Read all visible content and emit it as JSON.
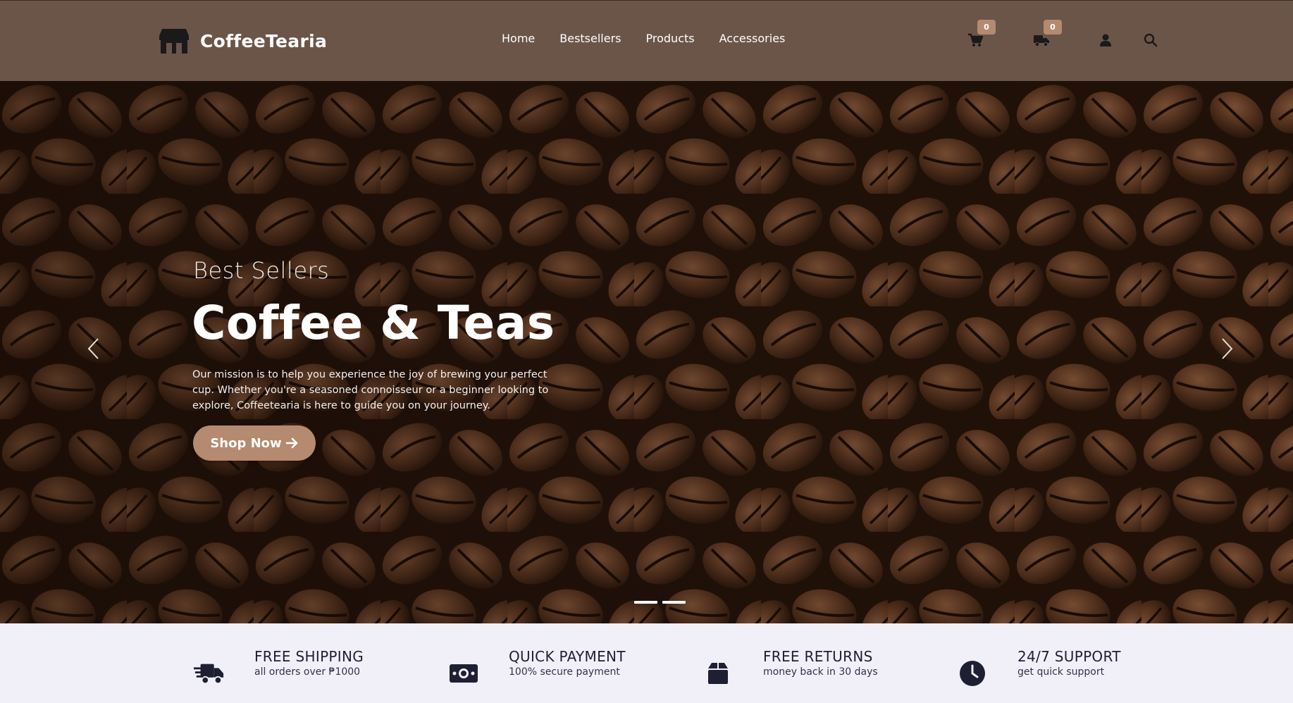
{
  "header": {
    "brand_name": "CoffeeTearia",
    "nav": [
      "Home",
      "Bestsellers",
      "Products",
      "Accessories"
    ],
    "cart_count": "0",
    "orders_count": "0",
    "icons": [
      "store-icon",
      "cart-icon",
      "truck-icon",
      "user-icon",
      "search-icon"
    ]
  },
  "hero": {
    "subtitle": "Best Sellers",
    "title": "Coffee & Teas",
    "description": "Our mission is to help you experience the joy of brewing your perfect cup. Whether you're a seasoned connoisseur or a beginner looking to explore, Coffeetearia is here to guide you on your journey.",
    "cta_label": "Shop Now",
    "slides": 2
  },
  "features": [
    {
      "title": "FREE SHIPPING",
      "desc": "all orders over ₱1000",
      "icon": "shipping-truck-icon"
    },
    {
      "title": "QUICK PAYMENT",
      "desc": "100% secure payment",
      "icon": "money-bill-icon"
    },
    {
      "title": "FREE RETURNS",
      "desc": "money back in 30 days",
      "icon": "box-icon"
    },
    {
      "title": "24/7 SUPPORT",
      "desc": "get quick support",
      "icon": "clock-icon"
    }
  ],
  "colors": {
    "header_bg": "#6b5549",
    "accent": "#b48a70",
    "features_bg": "#f1eff8",
    "text_dark": "#1f1f33"
  }
}
